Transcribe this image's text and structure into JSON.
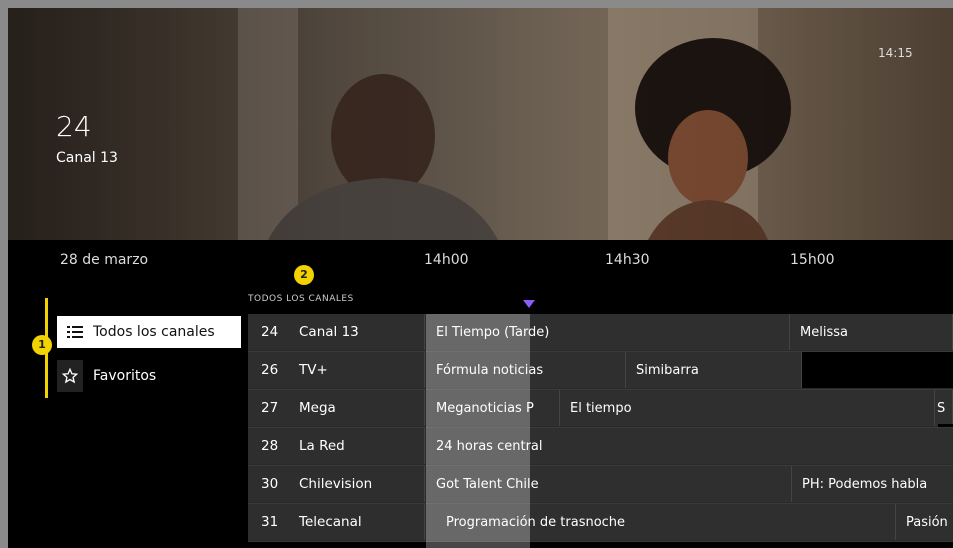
{
  "hero": {
    "channel_number": "24",
    "channel_name": "Canal 13",
    "clock": "14:15"
  },
  "timebar": {
    "date": "28 de marzo",
    "times": [
      "14h00",
      "14h30",
      "15h00"
    ]
  },
  "badges": {
    "one": "1",
    "two": "2"
  },
  "sidebar": {
    "items": [
      {
        "label": "Todos los canales",
        "icon": "list-icon"
      },
      {
        "label": "Favoritos",
        "icon": "star-icon"
      }
    ]
  },
  "guide": {
    "section_label": "TODOS LOS CANALES",
    "rows": [
      {
        "number": "24",
        "name": "Canal 13",
        "programs": [
          "El Tiempo (Tarde)",
          "Melissa"
        ]
      },
      {
        "number": "26",
        "name": "TV+",
        "programs": [
          "Fórmula noticias",
          "Simibarra"
        ]
      },
      {
        "number": "27",
        "name": "Mega",
        "programs": [
          "Meganoticias P",
          "El tiempo",
          "S"
        ]
      },
      {
        "number": "28",
        "name": "La Red",
        "programs": [
          "24 horas central"
        ]
      },
      {
        "number": "30",
        "name": "Chilevision",
        "programs": [
          "Got Talent Chile",
          "PH: Podemos habla"
        ]
      },
      {
        "number": "31",
        "name": "Telecanal",
        "programs": [
          "Programación de trasnoche",
          "Pasión"
        ]
      }
    ]
  }
}
